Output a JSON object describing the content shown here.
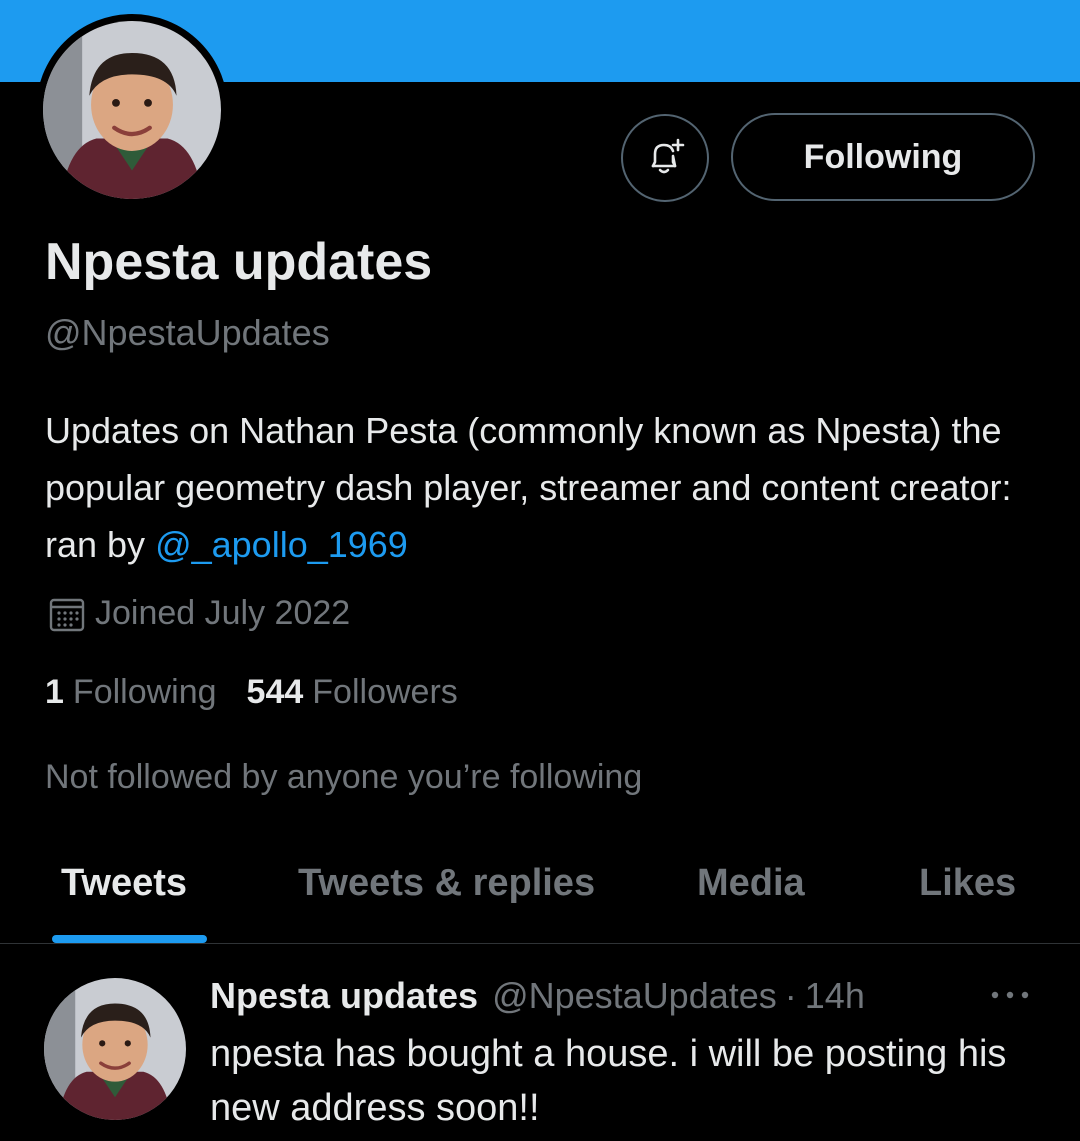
{
  "profile": {
    "display_name": "Npesta updates",
    "handle": "@NpestaUpdates",
    "bio_text": "Updates on Nathan Pesta (commonly known as Npesta) the popular geometry dash player, streamer and content creator: ran by ",
    "bio_mention": "@_apollo_1969",
    "joined": "Joined July 2022",
    "following_count": "1",
    "following_label": "Following",
    "followers_count": "544",
    "followers_label": "Followers",
    "not_followed_text": "Not followed by anyone you’re following"
  },
  "actions": {
    "follow_button_label": "Following",
    "bell_icon": "notification-bell-plus-icon"
  },
  "tabs": [
    {
      "label": "Tweets",
      "active": true
    },
    {
      "label": "Tweets & replies",
      "active": false
    },
    {
      "label": "Media",
      "active": false
    },
    {
      "label": "Likes",
      "active": false
    }
  ],
  "tweet": {
    "author_name": "Npesta updates",
    "author_handle": "@NpestaUpdates",
    "separator": "·",
    "time": "14h",
    "text": "npesta has bought a house. i will be posting his new address soon!!"
  },
  "colors": {
    "accent": "#1d9bf0",
    "background": "#000000",
    "text_primary": "#e7e9ea",
    "text_secondary": "#71767b"
  }
}
